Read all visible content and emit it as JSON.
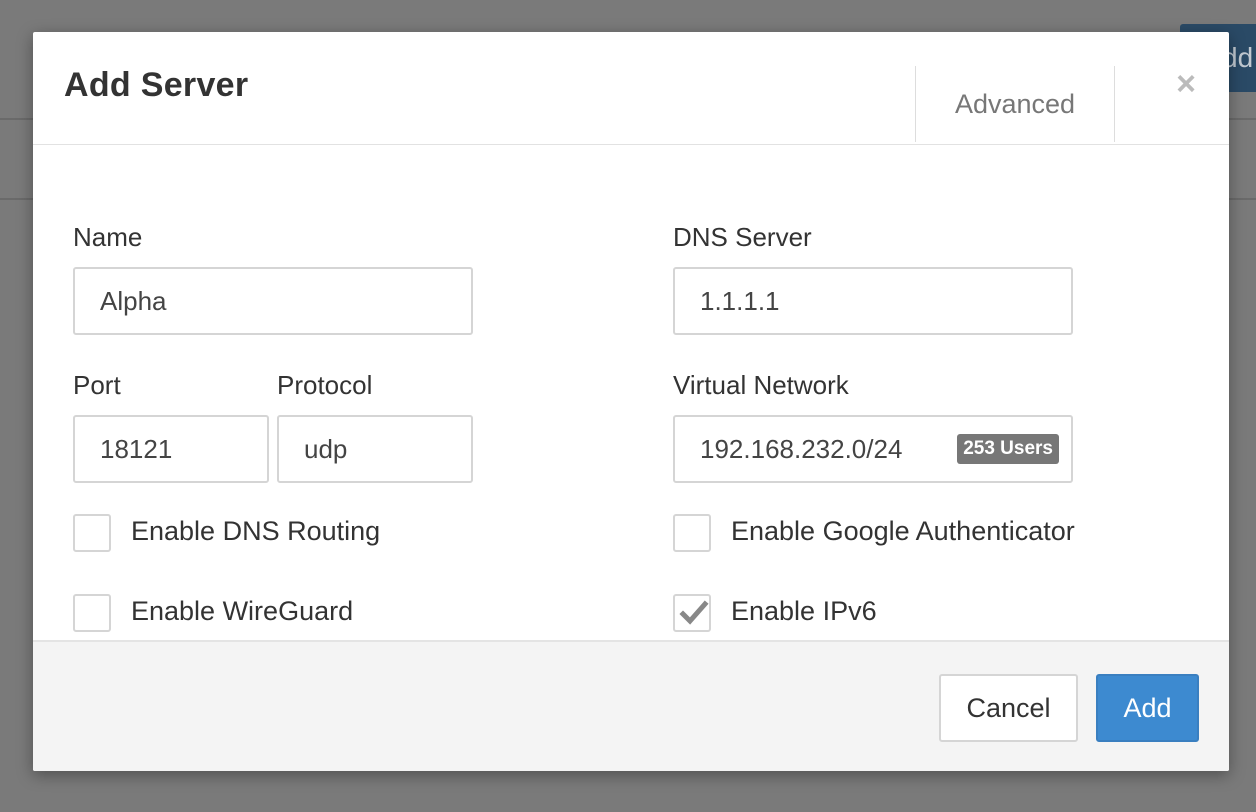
{
  "background": {
    "add_button_label": "dd"
  },
  "modal": {
    "title": "Add Server",
    "advanced_tab": "Advanced",
    "close_glyph": "×",
    "fields": {
      "name": {
        "label": "Name",
        "value": "Alpha"
      },
      "dns_server": {
        "label": "DNS Server",
        "value": "1.1.1.1"
      },
      "port": {
        "label": "Port",
        "value": "18121"
      },
      "protocol": {
        "label": "Protocol",
        "value": "udp"
      },
      "virtual_network": {
        "label": "Virtual Network",
        "value": "192.168.232.0/24",
        "badge": "253 Users"
      }
    },
    "checkboxes": {
      "dns_routing": {
        "label": "Enable DNS Routing",
        "checked": false
      },
      "wireguard": {
        "label": "Enable WireGuard",
        "checked": false
      },
      "google_authenticator": {
        "label": "Enable Google Authenticator",
        "checked": false
      },
      "ipv6": {
        "label": "Enable IPv6",
        "checked": true
      }
    },
    "footer": {
      "cancel_label": "Cancel",
      "add_label": "Add"
    }
  },
  "colors": {
    "primary": "#3d8ad0",
    "badge": "#777777",
    "overlay": "#7a7a7a"
  },
  "icons": {
    "close": "close-icon",
    "check": "checkmark-icon"
  }
}
